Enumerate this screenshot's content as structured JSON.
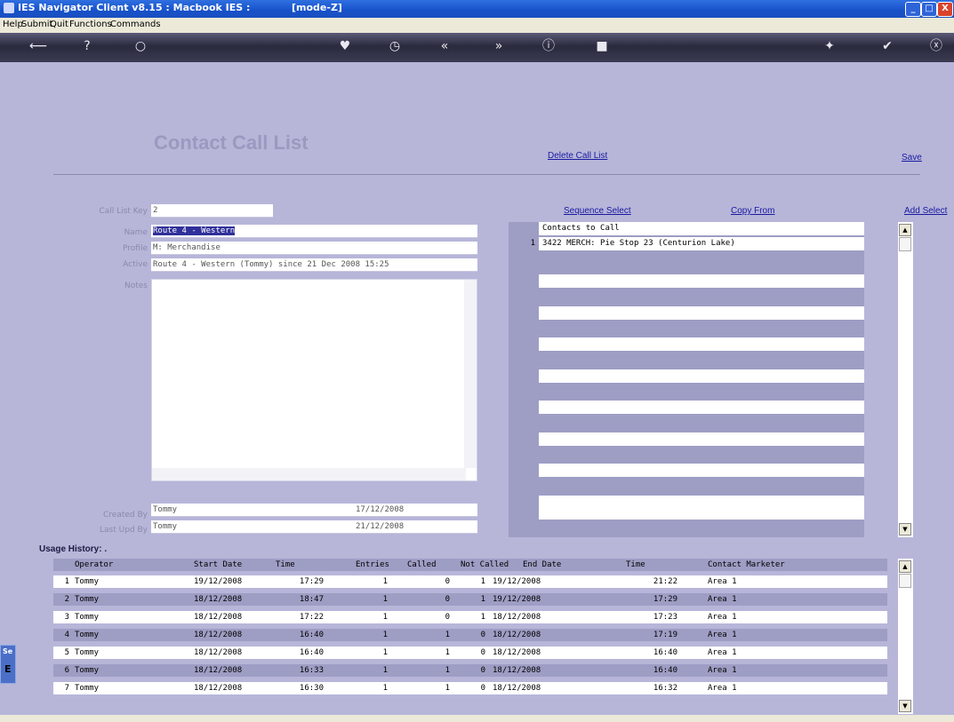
{
  "window": {
    "title": "IES Navigator Client v8.15 : Macbook IES :",
    "mode": "[mode-Z]",
    "controls": [
      "_",
      "□",
      "X"
    ]
  },
  "menu": [
    "Help",
    "Submit",
    "Quit",
    "Functions",
    "Commands"
  ],
  "toolbar": {
    "icons": [
      "back-icon",
      "help-icon",
      "search-icon",
      "heart-icon",
      "clock-icon",
      "first-icon",
      "last-icon",
      "info-icon",
      "stop-icon",
      "gear-icon",
      "check-icon",
      "close-icon"
    ],
    "glyphs": [
      "⟵",
      "?",
      "○",
      "♥",
      "◷",
      "«",
      "»",
      "ⓘ",
      "■",
      "✦",
      "✔",
      "ⓧ"
    ]
  },
  "page": {
    "title": "Contact Call List",
    "delete_link": "Delete Call List",
    "save_link": "Save"
  },
  "form": {
    "call_list_key_label": "Call List Key",
    "call_list_key": "2",
    "name_label": "Name",
    "name": "Route 4 - Western",
    "profile_label": "Profile",
    "profile": "M: Merchandise",
    "active_label": "Active",
    "active": "Route 4 - Western (Tommy) since 21 Dec 2008 15:25",
    "notes_label": "Notes",
    "notes": "",
    "created_by_label": "Created By",
    "created_by": "Tommy",
    "created_date": "17/12/2008",
    "last_upd_by_label": "Last Upd By",
    "last_upd_by": "Tommy",
    "last_upd_date": "21/12/2008"
  },
  "contacts": {
    "sequence_select_link": "Sequence Select",
    "copy_from_link": "Copy From",
    "add_select_link": "Add Select",
    "header": "Contacts to Call",
    "rows": [
      {
        "num": "1",
        "text": "3422 MERCH: Pie Stop 23 (Centurion Lake)"
      }
    ]
  },
  "usage": {
    "title": "Usage History: .",
    "headers": {
      "operator": "Operator",
      "start_date": "Start Date",
      "time": "Time",
      "entries": "Entries",
      "called": "Called",
      "not_called": "Not Called",
      "end_date": "End Date",
      "time2": "Time",
      "contact_marketer": "Contact Marketer"
    },
    "rows": [
      {
        "num": "1",
        "operator": "Tommy",
        "start": "19/12/2008",
        "time": "17:29",
        "entries": "1",
        "called": "0",
        "notcalled": "1",
        "end": "19/12/2008",
        "time2": "21:22",
        "marketer": "Area 1"
      },
      {
        "num": "2",
        "operator": "Tommy",
        "start": "18/12/2008",
        "time": "18:47",
        "entries": "1",
        "called": "0",
        "notcalled": "1",
        "end": "19/12/2008",
        "time2": "17:29",
        "marketer": "Area 1"
      },
      {
        "num": "3",
        "operator": "Tommy",
        "start": "18/12/2008",
        "time": "17:22",
        "entries": "1",
        "called": "0",
        "notcalled": "1",
        "end": "18/12/2008",
        "time2": "17:23",
        "marketer": "Area 1"
      },
      {
        "num": "4",
        "operator": "Tommy",
        "start": "18/12/2008",
        "time": "16:40",
        "entries": "1",
        "called": "1",
        "notcalled": "0",
        "end": "18/12/2008",
        "time2": "17:19",
        "marketer": "Area 1"
      },
      {
        "num": "5",
        "operator": "Tommy",
        "start": "18/12/2008",
        "time": "16:40",
        "entries": "1",
        "called": "1",
        "notcalled": "0",
        "end": "18/12/2008",
        "time2": "16:40",
        "marketer": "Area 1"
      },
      {
        "num": "6",
        "operator": "Tommy",
        "start": "18/12/2008",
        "time": "16:33",
        "entries": "1",
        "called": "1",
        "notcalled": "0",
        "end": "18/12/2008",
        "time2": "16:40",
        "marketer": "Area 1"
      },
      {
        "num": "7",
        "operator": "Tommy",
        "start": "18/12/2008",
        "time": "16:30",
        "entries": "1",
        "called": "1",
        "notcalled": "0",
        "end": "18/12/2008",
        "time2": "16:32",
        "marketer": "Area 1"
      }
    ]
  },
  "sidetab": {
    "t1": "Se",
    "t2": "E"
  },
  "colors": {
    "background": "#b7b6d9",
    "panel": "#9e9dc4",
    "row_alt": "#9e9dc4",
    "link": "#1a1aa0",
    "titlebar": "#1751c9"
  }
}
